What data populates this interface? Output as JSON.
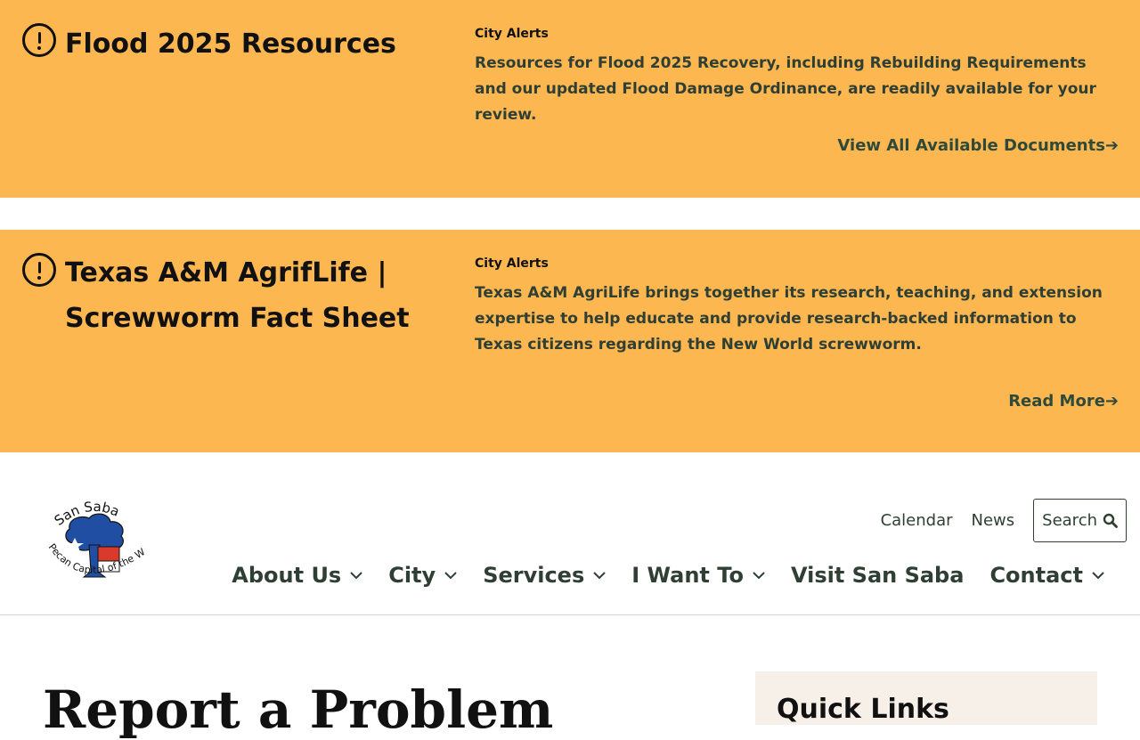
{
  "alerts": [
    {
      "title": "Flood 2025 Resources",
      "category": "City Alerts",
      "body": "Resources for Flood 2025 Recovery, including Rebuilding Requirements and our updated Flood Damage Ordinance, are readily available for your review.",
      "link": "View All Available Documents➔"
    },
    {
      "title": "Texas A&M AgrifLife | Screwworm Fact Sheet",
      "category": "City Alerts",
      "body": "Texas A&M AgriLife brings together its research, teaching, and extension expertise to help educate and provide research-backed information to Texas citizens regarding the New World screwworm.",
      "link": "Read More➔"
    }
  ],
  "header": {
    "logo": {
      "top_text": "San Saba",
      "ring_text": "Pecan Capital of the World",
      "icon": "san-saba-logo"
    },
    "utility_links": [
      "Calendar",
      "News"
    ],
    "search_label": "Search",
    "nav": [
      {
        "label": "About Us",
        "dropdown": true
      },
      {
        "label": "City",
        "dropdown": true
      },
      {
        "label": "Services",
        "dropdown": true
      },
      {
        "label": "I Want To",
        "dropdown": true
      },
      {
        "label": "Visit San Saba",
        "dropdown": false
      },
      {
        "label": "Contact",
        "dropdown": true
      }
    ]
  },
  "main": {
    "page_title": "Report a Problem",
    "quick_links_title": "Quick Links"
  },
  "colors": {
    "alert_bg": "#fdb751",
    "text_dark": "#2f3f34",
    "sidebar_bg": "#f7f0e8"
  }
}
